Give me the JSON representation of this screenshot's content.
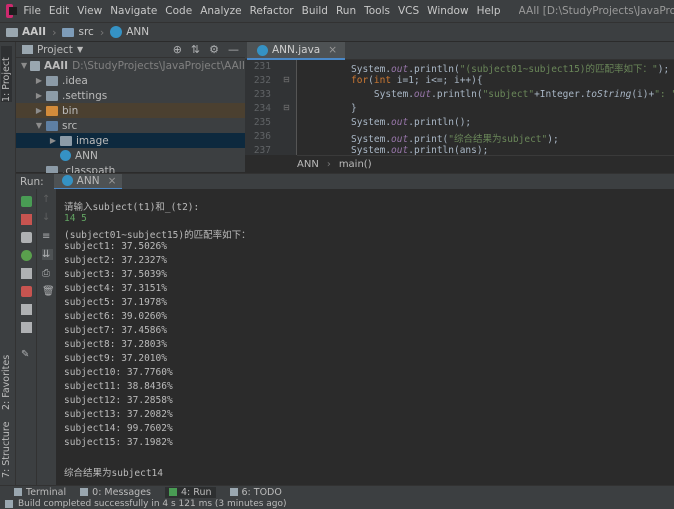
{
  "menu": {
    "items": [
      "File",
      "Edit",
      "View",
      "Navigate",
      "Code",
      "Analyze",
      "Refactor",
      "Build",
      "Run",
      "Tools",
      "VCS",
      "Window",
      "Help"
    ],
    "window_title": "AAII [D:\\StudyProjects\\JavaProject\\AAII] - ...\\src\\ANN.java"
  },
  "navbar": {
    "crumbs": [
      "AAII",
      "src",
      "ANN"
    ]
  },
  "left_stripe": {
    "project": "1: Project",
    "favorites": "2: Favorites",
    "structure": "7: Structure"
  },
  "project": {
    "header": "Project",
    "tree": [
      {
        "label": "AAII",
        "path": "D:\\StudyProjects\\JavaProject\\AAII",
        "indent": 0,
        "expanded": true,
        "icon": "folder-gray"
      },
      {
        "label": ".idea",
        "indent": 1,
        "expanded": false,
        "icon": "folder"
      },
      {
        "label": ".settings",
        "indent": 1,
        "expanded": false,
        "icon": "folder"
      },
      {
        "label": "bin",
        "indent": 1,
        "expanded": false,
        "icon": "folder-orange",
        "highlight": true
      },
      {
        "label": "src",
        "indent": 1,
        "expanded": true,
        "icon": "folder-blue"
      },
      {
        "label": "image",
        "indent": 2,
        "expanded": false,
        "icon": "folder",
        "selected": true
      },
      {
        "label": "ANN",
        "indent": 2,
        "icon": "class"
      },
      {
        "label": ".classpath",
        "indent": 1,
        "icon": "file"
      }
    ]
  },
  "editor": {
    "tab": "ANN.java",
    "line_numbers": [
      "231",
      "232",
      "233",
      "234",
      "235",
      "236",
      "237"
    ],
    "code_lines": [
      "System.out.println(\"(subject01~subject15)的匹配率如下：\");",
      "for(int i=1; i<=; i++){",
      "    System.out.println(\"subject\"+Integer.toString(i)+\": \"+String.f",
      "}",
      "System.out.println();",
      "System.out.print(\"综合结果为subject\");",
      "System.out.println(ans);"
    ],
    "breadcrumb": [
      "ANN",
      "main()"
    ]
  },
  "run": {
    "label": "Run:",
    "tab": "ANN",
    "console": [
      {
        "text": "请输入subject(t1)和_(t2):",
        "input": false
      },
      {
        "text": "14 5",
        "input": true
      },
      {
        "text": "(subject01~subject15)的匹配率如下：",
        "input": false
      },
      {
        "text": "subject1: 37.5026%",
        "input": false
      },
      {
        "text": "subject2: 37.2327%",
        "input": false
      },
      {
        "text": "subject3: 37.5039%",
        "input": false
      },
      {
        "text": "subject4: 37.3151%",
        "input": false
      },
      {
        "text": "subject5: 37.1978%",
        "input": false
      },
      {
        "text": "subject6: 39.0260%",
        "input": false
      },
      {
        "text": "subject7: 37.4586%",
        "input": false
      },
      {
        "text": "subject8: 37.2803%",
        "input": false
      },
      {
        "text": "subject9: 37.2010%",
        "input": false
      },
      {
        "text": "subject10: 37.7760%",
        "input": false
      },
      {
        "text": "subject11: 38.8436%",
        "input": false
      },
      {
        "text": "subject12: 37.2858%",
        "input": false
      },
      {
        "text": "subject13: 37.2082%",
        "input": false
      },
      {
        "text": "subject14: 99.7602%",
        "input": false
      },
      {
        "text": "subject15: 37.1982%",
        "input": false
      },
      {
        "text": "",
        "input": false
      },
      {
        "text": "综合结果为subject14",
        "input": false
      }
    ]
  },
  "bottom_tabs": [
    "Terminal",
    "0: Messages",
    "4: Run",
    "6: TODO"
  ],
  "status": "Build completed successfully in 4 s 121 ms (3 minutes ago)"
}
